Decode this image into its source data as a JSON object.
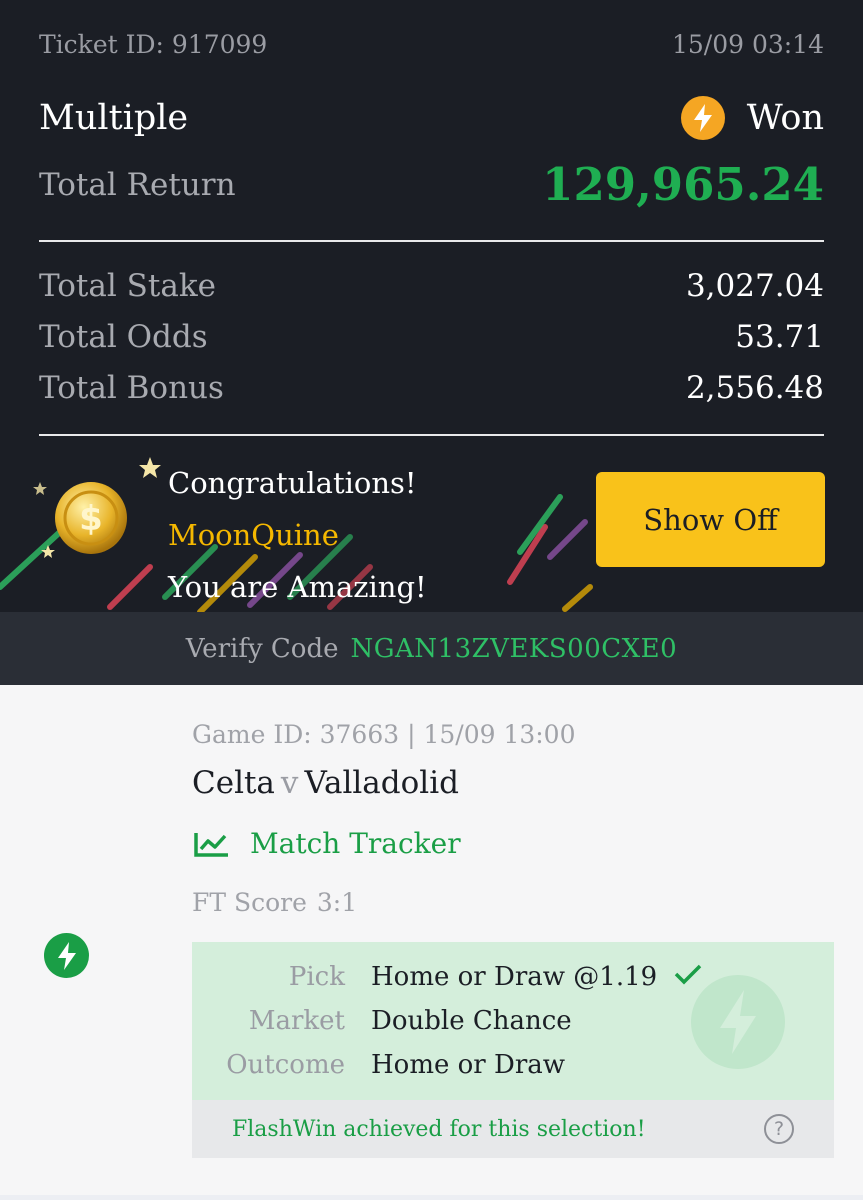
{
  "ticket": {
    "id_label": "Ticket ID: 917099",
    "datetime": "15/09 03:14",
    "bet_type": "Multiple",
    "status": "Won",
    "status_icon": "lightning-bolt-icon",
    "total_return_label": "Total Return",
    "total_return": "129,965.24",
    "rows": [
      {
        "label": "Total Stake",
        "value": "3,027.04"
      },
      {
        "label": "Total Odds",
        "value": "53.71"
      },
      {
        "label": "Total Bonus",
        "value": "2,556.48"
      }
    ]
  },
  "congrats": {
    "line1": "Congratulations!",
    "username": "MoonQuine",
    "line3": "You are Amazing!",
    "button": "Show Off",
    "decoration": "gold-coin-icon"
  },
  "verify": {
    "label": "Verify Code",
    "code": "NGAN13ZVEKS00CXE0"
  },
  "game": {
    "meta": "Game ID: 37663 | 15/09 13:00",
    "home": "Celta",
    "vs": "v",
    "away": "Valladolid",
    "tracker_label": "Match Tracker",
    "ft_label": "FT Score",
    "ft_value": "3:1",
    "pick": {
      "label": "Pick",
      "value": "Home or Draw @1.19"
    },
    "market": {
      "label": "Market",
      "value": "Double Chance"
    },
    "outcome": {
      "label": "Outcome",
      "value": "Home or Draw"
    },
    "flash_note": "FlashWin achieved for this selection!",
    "help": "?"
  },
  "colors": {
    "dark_bg": "#1b1e25",
    "win_green": "#1fae52",
    "accent_yellow": "#f9c21a",
    "pick_bg": "#d4eedb"
  }
}
